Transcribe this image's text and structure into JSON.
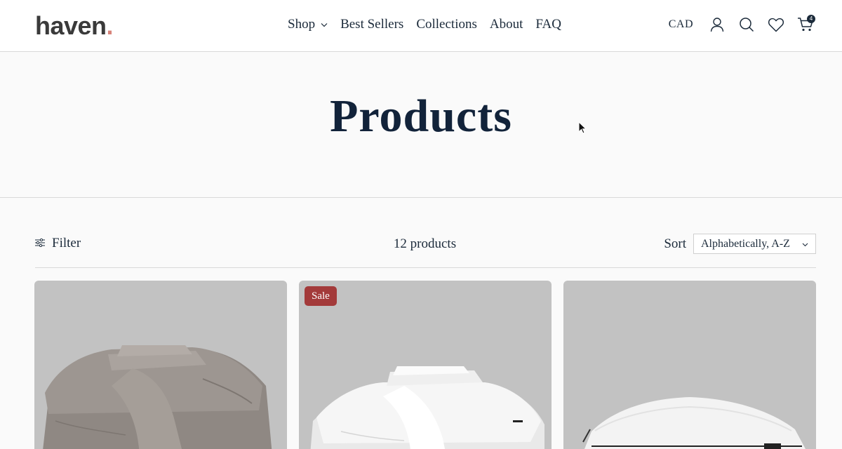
{
  "header": {
    "logo_text": "haven",
    "logo_dot": ".",
    "nav": [
      {
        "label": "Shop",
        "has_dropdown": true
      },
      {
        "label": "Best Sellers"
      },
      {
        "label": "Collections"
      },
      {
        "label": "About"
      },
      {
        "label": "FAQ"
      }
    ],
    "currency": "CAD",
    "cart_count": "4"
  },
  "page": {
    "title": "Products"
  },
  "toolbar": {
    "filter_label": "Filter",
    "product_count": "12 products",
    "sort_label": "Sort",
    "sort_value": "Alphabetically, A-Z"
  },
  "products": [
    {
      "badge": "",
      "image": "taupe-sheet-set"
    },
    {
      "badge": "Sale",
      "image": "white-sheet-set"
    },
    {
      "badge": "",
      "image": "white-pillow"
    }
  ],
  "colors": {
    "brand_dot": "#d8837a",
    "text": "#1b2a3a",
    "sale_badge": "#a33a3a",
    "card_bg": "#c2c2c2"
  }
}
